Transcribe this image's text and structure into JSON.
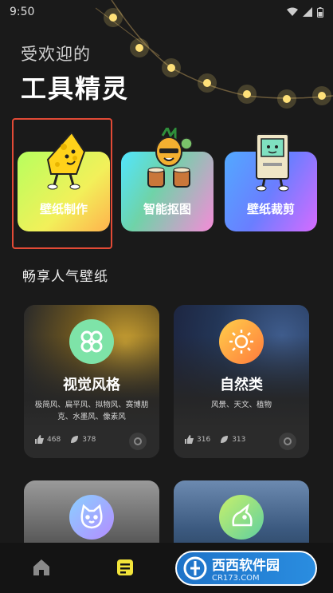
{
  "status_bar": {
    "time": "9:50"
  },
  "header": {
    "subtitle": "受欢迎的",
    "title": "工具精灵"
  },
  "tools": [
    {
      "label": "壁纸制作",
      "icon": "cheese-mascot-icon"
    },
    {
      "label": "智能抠图",
      "icon": "pineapple-drummer-icon"
    },
    {
      "label": "壁纸裁剪",
      "icon": "computer-mascot-icon"
    }
  ],
  "section": {
    "title": "畅享人气壁纸"
  },
  "wallpapers": [
    {
      "name": "视觉风格",
      "desc": "极简风、扁平风、拟物风、赛博朋克、水墨风、像素风",
      "likes": "468",
      "favs": "378",
      "icon": "clover-icon"
    },
    {
      "name": "自然类",
      "desc": "风景、天文、植物",
      "likes": "316",
      "favs": "313",
      "icon": "sun-icon"
    },
    {
      "name": "",
      "icon": "cat-face-icon"
    },
    {
      "name": "",
      "icon": "unicorn-icon"
    }
  ],
  "nav": {
    "home_icon": "home-icon",
    "wallpaper_icon": "wallpaper-list-icon"
  },
  "watermark": {
    "text": "西西软件园",
    "sub": "CR173.COM"
  },
  "colors": {
    "accent_yellow": "#f2e43a",
    "selection_red": "#e24a36",
    "background": "#1a1a1a"
  }
}
